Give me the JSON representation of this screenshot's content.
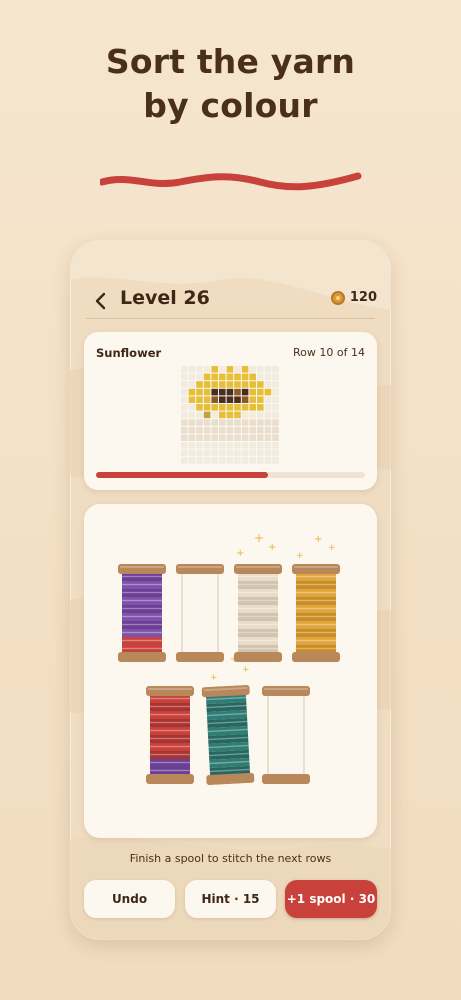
{
  "promo": {
    "headline_line1": "Sort the yarn",
    "headline_line2": "by colour",
    "squiggle_color": "#c8413b"
  },
  "header": {
    "back_icon": "chevron-left-icon",
    "level_title": "Level 26",
    "coin_icon": "coin-icon",
    "coins": "120"
  },
  "pattern": {
    "name": "Sunflower",
    "row_status": "Row 10 of 14",
    "progress": 0.64,
    "progress_color": "#c8413b"
  },
  "spools": [
    {
      "name": "purple",
      "colors": [
        "#6b3f94",
        "#7e52a8"
      ],
      "fill_levels": 4,
      "tail_color": "#c8413b"
    },
    {
      "name": "empty",
      "colors": [],
      "fill_levels": 0
    },
    {
      "name": "cream",
      "colors": [
        "#e8dccb",
        "#d2c3ac"
      ],
      "fill_levels": 4
    },
    {
      "name": "gold",
      "colors": [
        "#e0a53c",
        "#c98c26"
      ],
      "fill_levels": 4
    },
    {
      "name": "red",
      "colors": [
        "#c8413b",
        "#a83330"
      ],
      "fill_levels": 3,
      "tail_color": "#6b3f94"
    },
    {
      "name": "teal",
      "colors": [
        "#2f7d74",
        "#26675f"
      ],
      "fill_levels": 4
    },
    {
      "name": "empty",
      "colors": [],
      "fill_levels": 0
    }
  ],
  "board": {
    "instruction": "Finish a spool to stitch the next rows"
  },
  "actions": {
    "undo": "Undo",
    "hint": "Hint · 15",
    "add_spool": "+1 spool · 30"
  }
}
